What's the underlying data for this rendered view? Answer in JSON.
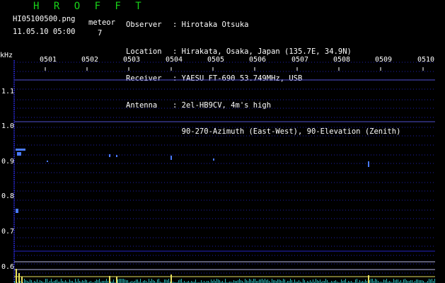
{
  "header": {
    "brand": "H R O F F T",
    "filename": "HI05100500.png",
    "datetime": "11.05.10 05:00",
    "meteor_label": "meteor",
    "meteor_count": "7",
    "info": [
      {
        "key": "Observer",
        "value": ": Hirotaka Otsuka"
      },
      {
        "key": "Location",
        "value": ": Hirakata, Osaka, Japan (135.7E, 34.9N)"
      },
      {
        "key": "Receiver",
        "value": ": YAESU FT-690 53.749MHz, USB"
      },
      {
        "key": "Antenna",
        "value": ": 2el-HB9CV, 4m's high"
      },
      {
        "key": "",
        "value": "  90-270-Azimuth (East-West), 90-Elevation (Zenith)"
      }
    ]
  },
  "axis": {
    "unit": "kHz",
    "y_ticks": [
      "1.1",
      "1.0",
      "0.9",
      "0.8",
      "0.7",
      "0.6"
    ],
    "x_ticks": [
      "0501",
      "0502",
      "0503",
      "0504",
      "0505",
      "0506",
      "0507",
      "0508",
      "0509",
      "0510"
    ]
  },
  "colors": {
    "background": "#000000",
    "brand": "#19d319",
    "grid_dot": "#2a2ad8",
    "signal": "#4a7bff",
    "level_line": "#b8b8e8",
    "yellow_line": "#e8e060",
    "cyan_noise": "#30d8d8"
  }
}
